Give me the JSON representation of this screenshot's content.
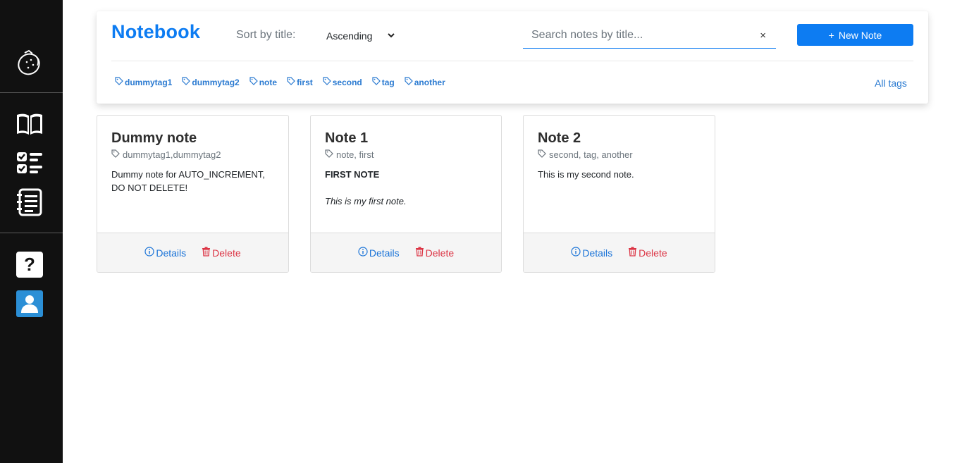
{
  "sidebar": {
    "icons": [
      "lemon-logo-icon",
      "book-icon",
      "checklist-icon",
      "notes-list-icon",
      "help-icon",
      "user-icon"
    ],
    "help_label": "?"
  },
  "header": {
    "brand": "Notebook",
    "sort_label": "Sort by title:",
    "sort_value": "Ascending",
    "search_placeholder": "Search notes by title...",
    "clear_symbol": "×",
    "new_note_label": "New Note",
    "new_note_icon": "+",
    "all_tags_label": "All tags",
    "accent_color": "#0d7cf2"
  },
  "tags": [
    "dummytag1",
    "dummytag2",
    "note",
    "first",
    "second",
    "tag",
    "another"
  ],
  "notes": [
    {
      "title": "Dummy note",
      "tags": "dummytag1,dummytag2",
      "line1": "Dummy note for AUTO_INCREMENT,",
      "line2": "DO NOT DELETE!"
    },
    {
      "title": "Note 1",
      "tags": "note, first",
      "heading": "FIRST NOTE",
      "text": "This is my first note."
    },
    {
      "title": "Note 2",
      "tags": "second, tag, another",
      "text": "This is my second note."
    }
  ],
  "actions": {
    "details_label": "Details",
    "delete_label": "Delete"
  }
}
